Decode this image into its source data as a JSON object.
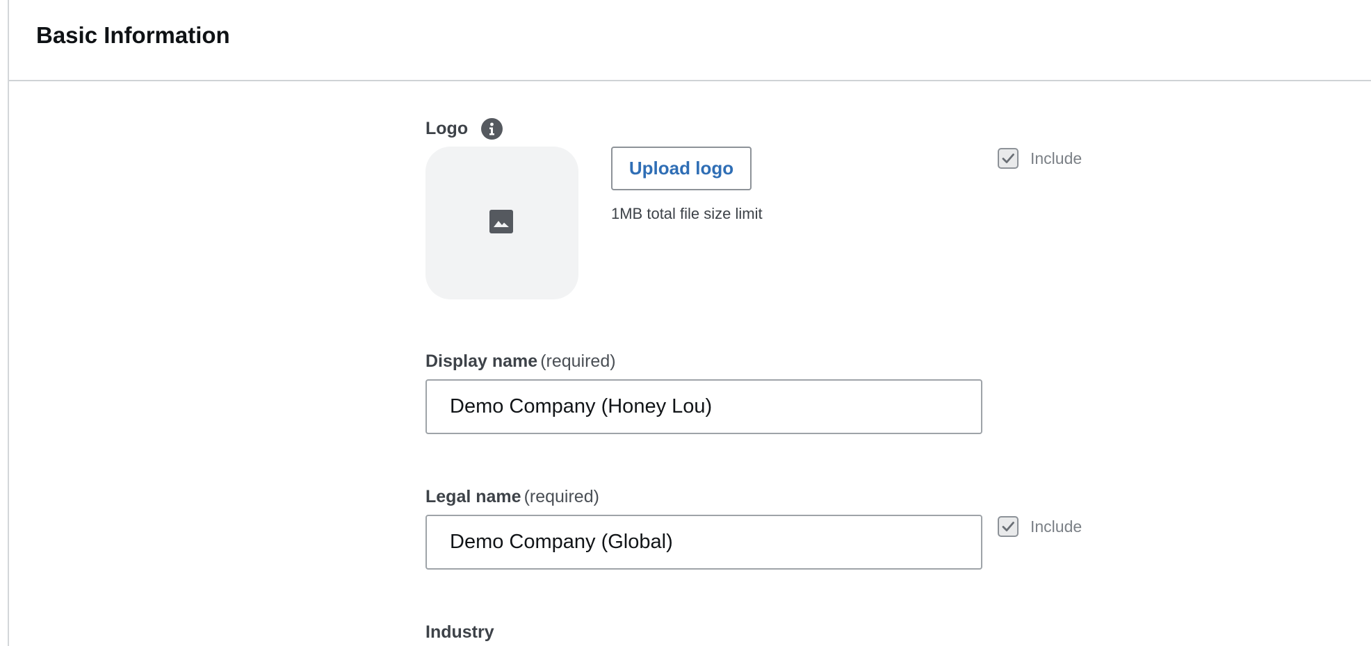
{
  "header": {
    "title": "Basic Information"
  },
  "logo": {
    "label": "Logo",
    "info_icon": "info-icon",
    "placeholder_icon": "image-icon",
    "upload_button_label": "Upload logo",
    "helper_text": "1MB total file size limit",
    "include_label": "Include",
    "include_checked": true
  },
  "display_name": {
    "label": "Display name",
    "required_text": "(required)",
    "value": "Demo Company (Honey Lou)"
  },
  "legal_name": {
    "label": "Legal name",
    "required_text": "(required)",
    "value": "Demo Company (Global)",
    "include_label": "Include",
    "include_checked": true
  },
  "industry": {
    "label": "Industry"
  },
  "colors": {
    "link_blue": "#2f6eb5",
    "border_gray": "#8d9298",
    "label_gray": "#3d4248",
    "muted_gray": "#7b8086",
    "logo_bg": "#f2f3f4"
  }
}
